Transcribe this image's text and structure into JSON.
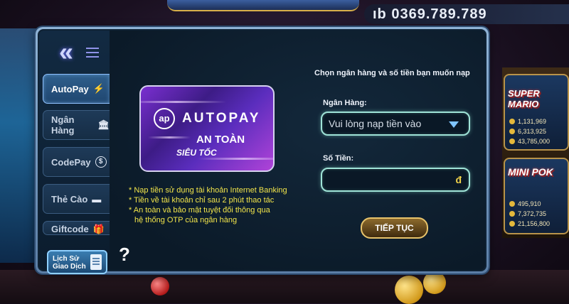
{
  "background": {
    "phone_text": "ıb 0369.789.789",
    "jackpots": [
      {
        "title": "SUPER MARIO",
        "values": [
          "1,131,969",
          "6,313,925",
          "43,785,000"
        ]
      },
      {
        "title": "MINI POK",
        "values": [
          "495,910",
          "7,372,735",
          "21,156,800"
        ]
      }
    ]
  },
  "sidebar": {
    "back_icon": "double-chevron-left-icon",
    "tabs": [
      {
        "label": "AutoPay",
        "icon": "⚡",
        "active": true
      },
      {
        "label": "Ngân Hàng",
        "icon": "🏛"
      },
      {
        "label": "CodePay",
        "icon": "$"
      },
      {
        "label": "Thẻ Cào",
        "icon": "▬"
      },
      {
        "label": "Giftcode",
        "icon": "🎁"
      }
    ],
    "history_button": {
      "line1": "Lịch Sử",
      "line2": "Giao Dịch"
    }
  },
  "promo_card": {
    "logo": "ap",
    "name": "AUTOPAY",
    "line1": "AN TOÀN",
    "line2": "SIÊU TỐC"
  },
  "notes": [
    "* Nạp tiền sử dụng tài khoản Internet Banking",
    "* Tiền về tài khoản chỉ sau 2 phút thao tác",
    "* An toàn và bảo mật tuyệt đối thông qua",
    "hệ thống OTP của ngân hàng"
  ],
  "help_label": "?",
  "form": {
    "title": "Chọn ngân hàng và số tiền bạn muốn nạp",
    "bank_label": "Ngân Hàng:",
    "bank_value": "Vui lòng nạp tiền vào",
    "amount_label": "Số Tiền:",
    "amount_value": "",
    "currency": "đ",
    "submit_label": "TIẾP TỤC"
  },
  "colors": {
    "notes": "#f1e44a",
    "field_border": "#9fe3d7",
    "submit_border": "#e7c36b"
  }
}
